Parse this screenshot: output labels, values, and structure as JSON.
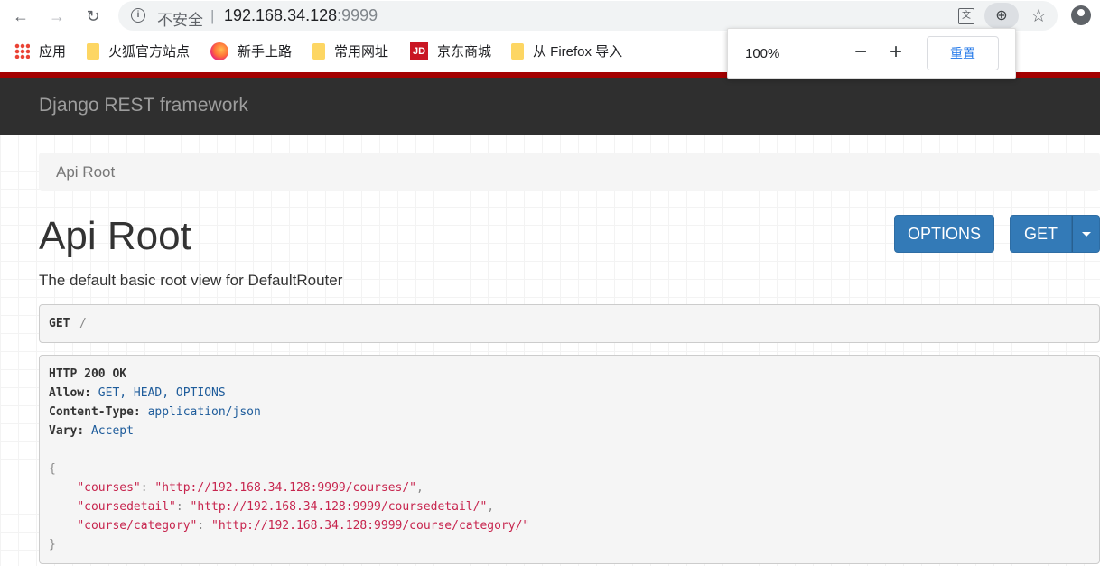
{
  "browser": {
    "insecure_label": "不安全",
    "separator": "|",
    "url_host": "192.168.34.128",
    "url_port": ":9999",
    "bookmarks": [
      {
        "label": "应用"
      },
      {
        "label": "火狐官方站点"
      },
      {
        "label": "新手上路"
      },
      {
        "label": "常用网址"
      },
      {
        "label": "京东商城"
      },
      {
        "label": "从 Firefox 导入"
      }
    ],
    "jd_icon_text": "JD",
    "zoom_popup": {
      "level": "100%",
      "minus": "−",
      "plus": "+",
      "reset": "重置"
    }
  },
  "drf": {
    "brand": "Django REST framework",
    "breadcrumb": "Api Root",
    "title": "Api Root",
    "options_button": "OPTIONS",
    "get_button": "GET",
    "description": "The default basic root view for DefaultRouter",
    "request": {
      "method": "GET",
      "path": "/"
    },
    "response": {
      "status": "HTTP 200 OK",
      "headers": [
        {
          "name": "Allow",
          "value": "GET, HEAD, OPTIONS"
        },
        {
          "name": "Content-Type",
          "value": "application/json"
        },
        {
          "name": "Vary",
          "value": "Accept"
        }
      ],
      "open_brace": "{",
      "close_brace": "}",
      "entries": [
        {
          "key": "\"courses\"",
          "value": "\"http://192.168.34.128:9999/courses/\"",
          "sep": ","
        },
        {
          "key": "\"coursedetail\"",
          "value": "\"http://192.168.34.128:9999/coursedetail/\"",
          "sep": ","
        },
        {
          "key": "\"course/category\"",
          "value": "\"http://192.168.34.128:9999/course/category/\"",
          "sep": ""
        }
      ]
    }
  }
}
